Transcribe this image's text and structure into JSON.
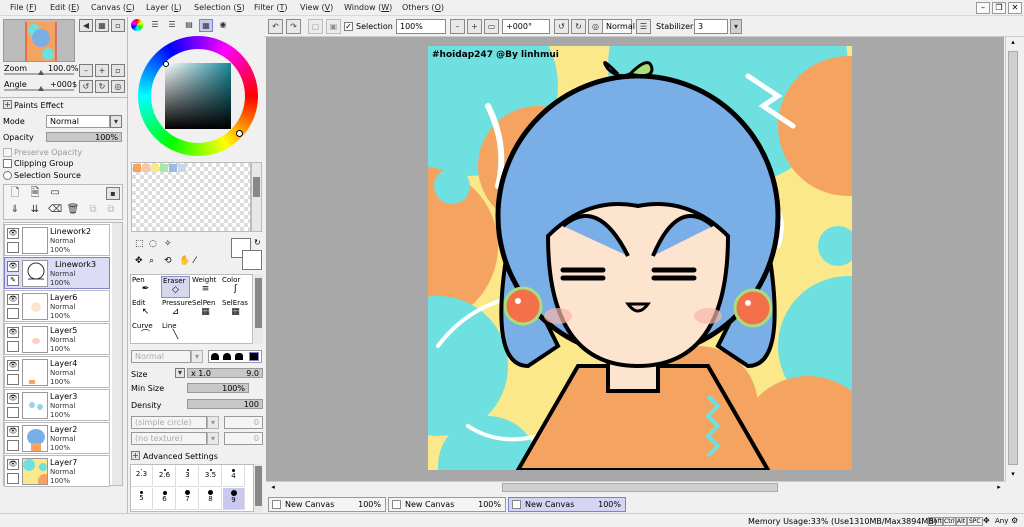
{
  "menu": [
    {
      "label": "File",
      "key": "F"
    },
    {
      "label": "Edit",
      "key": "E"
    },
    {
      "label": "Canvas",
      "key": "C"
    },
    {
      "label": "Layer",
      "key": "L"
    },
    {
      "label": "Selection",
      "key": "S"
    },
    {
      "label": "Filter",
      "key": "T"
    },
    {
      "label": "View",
      "key": "V"
    },
    {
      "label": "Window",
      "key": "W"
    },
    {
      "label": "Others",
      "key": "O"
    }
  ],
  "toolbar": {
    "selection_label": "Selection",
    "zoom_value": "100%",
    "angle_value": "+000°",
    "blend_mode": "Normal",
    "stabilizer_label": "Stabilizer",
    "stabilizer_value": "3"
  },
  "navigator": {
    "zoom_label": "Zoom",
    "zoom_value": "100.0%",
    "angle_label": "Angle",
    "angle_value": "+000$"
  },
  "layer_panel": {
    "paints_effect": "Paints Effect",
    "mode_label": "Mode",
    "mode_value": "Normal",
    "opacity_label": "Opacity",
    "opacity_value": "100%",
    "preserve_opacity": "Preserve Opacity",
    "clipping_group": "Clipping Group",
    "selection_source": "Selection Source",
    "layers": [
      {
        "name": "Linework2",
        "mode": "Normal",
        "opacity": "100%"
      },
      {
        "name": "Linework3",
        "mode": "Normal",
        "opacity": "100%"
      },
      {
        "name": "Layer6",
        "mode": "Normal",
        "opacity": "100%"
      },
      {
        "name": "Layer5",
        "mode": "Normal",
        "opacity": "100%"
      },
      {
        "name": "Layer4",
        "mode": "Normal",
        "opacity": "100%"
      },
      {
        "name": "Layer3",
        "mode": "Normal",
        "opacity": "100%"
      },
      {
        "name": "Layer2",
        "mode": "Normal",
        "opacity": "100%"
      },
      {
        "name": "Layer7",
        "mode": "Normal",
        "opacity": "100%"
      }
    ]
  },
  "tools": {
    "cells": [
      {
        "label": "Pen",
        "icon": "✒"
      },
      {
        "label": "Eraser",
        "icon": "◇"
      },
      {
        "label": "Weight",
        "icon": "≡"
      },
      {
        "label": "Color",
        "icon": "ʃ"
      },
      {
        "label": "Edit",
        "icon": "↖"
      },
      {
        "label": "Pressure",
        "icon": "⊿"
      },
      {
        "label": "SelPen",
        "icon": "▦"
      },
      {
        "label": "SelEras",
        "icon": "▦"
      },
      {
        "label": "Curve",
        "icon": "⌒"
      },
      {
        "label": "Line",
        "icon": "╲"
      }
    ],
    "blend_value": "Normal",
    "size_label": "Size",
    "size_multiplier": "x 1.0",
    "size_value": "9.0",
    "min_size_label": "Min Size",
    "min_size_value": "100%",
    "density_label": "Density",
    "density_value": "100",
    "shape_value": "(simple circle)",
    "shape_num": "0",
    "texture_value": "(no texture)",
    "texture_num": "0",
    "advanced_settings": "Advanced Settings",
    "brush_sizes": [
      "2.3",
      "2.6",
      "3",
      "3.5",
      "4",
      "5",
      "6",
      "7",
      "8",
      "9"
    ]
  },
  "canvas": {
    "watermark": "#hoidap247 @By linhmui"
  },
  "tabs": [
    {
      "name": "New Canvas",
      "zoom": "100%"
    },
    {
      "name": "New Canvas",
      "zoom": "100%"
    },
    {
      "name": "New Canvas",
      "zoom": "100%"
    }
  ],
  "status": {
    "memory": "Memory Usage:33% (Use1310MB/Max3894MB)",
    "keys": [
      "Shft",
      "Ctrl",
      "Alt",
      "SPC"
    ],
    "any": "Any"
  },
  "colors": {
    "canvas_bg": "#a8a8a8",
    "accent": "#8080d0",
    "hair": "#7aaee6",
    "orange": "#f4a460",
    "cyan": "#6ee0e0",
    "yellow": "#fbe88a"
  }
}
